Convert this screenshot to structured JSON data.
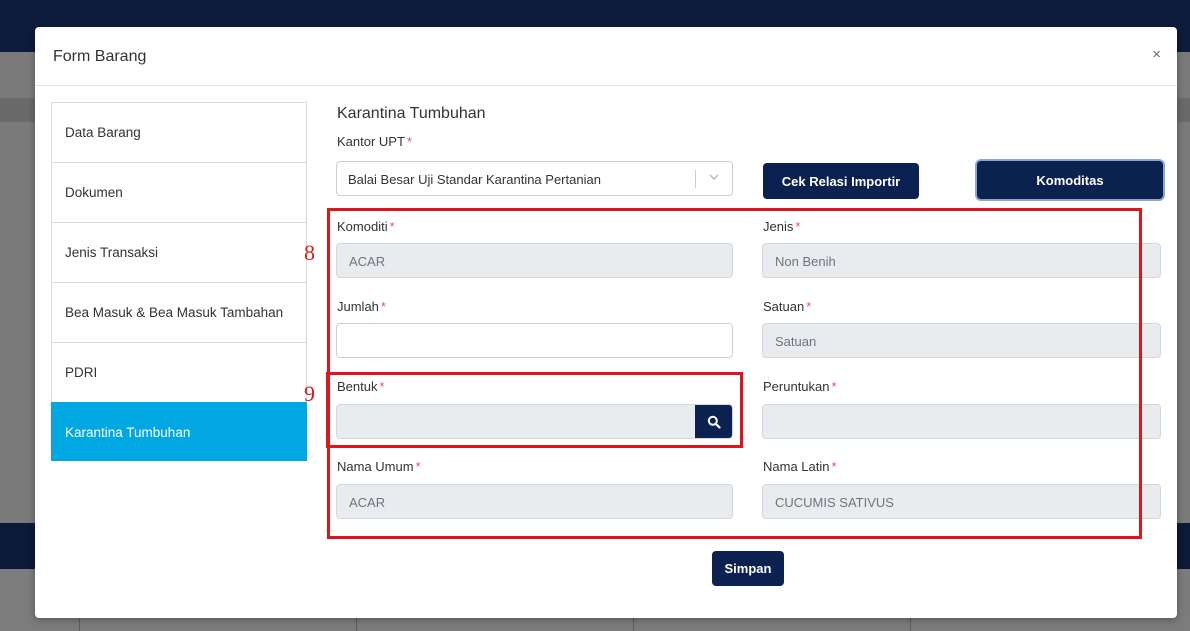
{
  "modal": {
    "title": "Form Barang",
    "close": "×"
  },
  "sidebar": {
    "items": [
      {
        "label": "Data Barang",
        "active": false
      },
      {
        "label": "Dokumen",
        "active": false
      },
      {
        "label": "Jenis Transaksi",
        "active": false
      },
      {
        "label": "Bea Masuk & Bea Masuk Tambahan",
        "active": false
      },
      {
        "label": "PDRI",
        "active": false
      },
      {
        "label": "Karantina Tumbuhan",
        "active": true
      }
    ]
  },
  "section": {
    "title": "Karantina Tumbuhan",
    "kantor_label": "Kantor UPT",
    "kantor_value": "Balai Besar Uji Standar Karantina Pertanian",
    "required_mark": "*"
  },
  "buttons": {
    "cek": "Cek Relasi Importir",
    "komoditas": "Komoditas",
    "simpan": "Simpan"
  },
  "fields": {
    "komoditi": {
      "label": "Komoditi",
      "value": "ACAR"
    },
    "jenis": {
      "label": "Jenis",
      "value": "Non Benih"
    },
    "jumlah": {
      "label": "Jumlah",
      "value": ""
    },
    "satuan": {
      "label": "Satuan",
      "value": "Satuan"
    },
    "bentuk": {
      "label": "Bentuk",
      "value": ""
    },
    "peruntukan": {
      "label": "Peruntukan",
      "value": ""
    },
    "nama_umum": {
      "label": "Nama Umum",
      "value": "ACAR"
    },
    "nama_latin": {
      "label": "Nama Latin",
      "value": "CUCUMIS SATIVUS"
    }
  },
  "annotations": {
    "n8": "8",
    "n9": "9"
  },
  "colors": {
    "primary_dark": "#0b2150",
    "active_tab": "#00a7e1",
    "annotation": "#e0141b",
    "required": "#e05b5b"
  },
  "icons": {
    "search": "search-icon",
    "dropdown": "chevron-down-icon",
    "close": "close-icon"
  }
}
